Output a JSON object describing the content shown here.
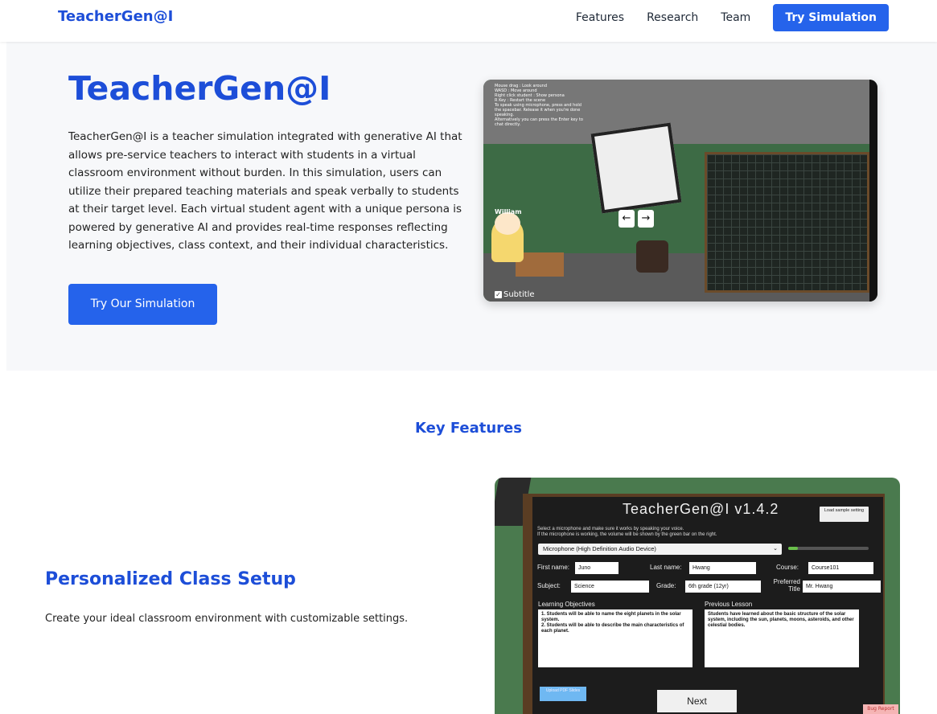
{
  "header": {
    "logo": "TeacherGen@I",
    "nav": [
      "Features",
      "Research",
      "Team"
    ],
    "cta": "Try Simulation"
  },
  "hero": {
    "title": "TeacherGen@I",
    "description": "TeacherGen@I is a teacher simulation integrated with generative AI that allows pre-service teachers to interact with students in a virtual classroom environment without burden. In this simulation, users can utilize their prepared teaching materials and speak verbally to students at their target level. Each virtual student agent with a unique persona is powered by generative AI and provides real-time responses reflecting learning objectives, class context, and their individual characteristics.",
    "button": "Try Our Simulation",
    "scene": {
      "student_name": "William",
      "subtitle_label": "Subtitle",
      "overlay_text": "Mouse drag : Look around\nWASD : Move around\nRight click student : Show persona\nR Key : Restart the scene\nTo speak using microphone, press and hold the spacebar. Release it when you're done speaking.\nAlternatively you can press the Enter key to chat directly."
    }
  },
  "features": {
    "section_title": "Key Features",
    "item_title": "Personalized Class Setup",
    "item_desc": "Create your ideal classroom environment with customizable settings."
  },
  "setup_screen": {
    "heading": "TeacherGen@I v1.4.2",
    "load_sample": "Load sample setting",
    "instructions": "Select a microphone and make sure it works by speaking your voice.\nIf the microphone is working, the volume will be shown by the green bar on the right.",
    "microphone": "Microphone (High Definition Audio Device)",
    "mic_level": 0.12,
    "first_name_label": "First name:",
    "first_name": "Juno",
    "last_name_label": "Last name:",
    "last_name": "Hwang",
    "course_label": "Course:",
    "course": "Course101",
    "subject_label": "Subject:",
    "subject": "Science",
    "grade_label": "Grade:",
    "grade": "6th grade (12yr)",
    "preferred_title_label": "Preferred Title",
    "preferred_title": "Mr. Hwang",
    "learning_objectives_label": "Learning Objectives",
    "learning_objectives": "1. Students will be able to name the eight planets in the solar system.\n2. Students will be able to describe the main characteristics of each planet.",
    "previous_lesson_label": "Previous Lesson",
    "previous_lesson": "Students have learned about the basic structure of the solar system, including the sun, planets, moons, asteroids, and other celestial bodies.",
    "upload": "Upload PDF Slides",
    "next": "Next",
    "bug_report": "Bug Report"
  }
}
